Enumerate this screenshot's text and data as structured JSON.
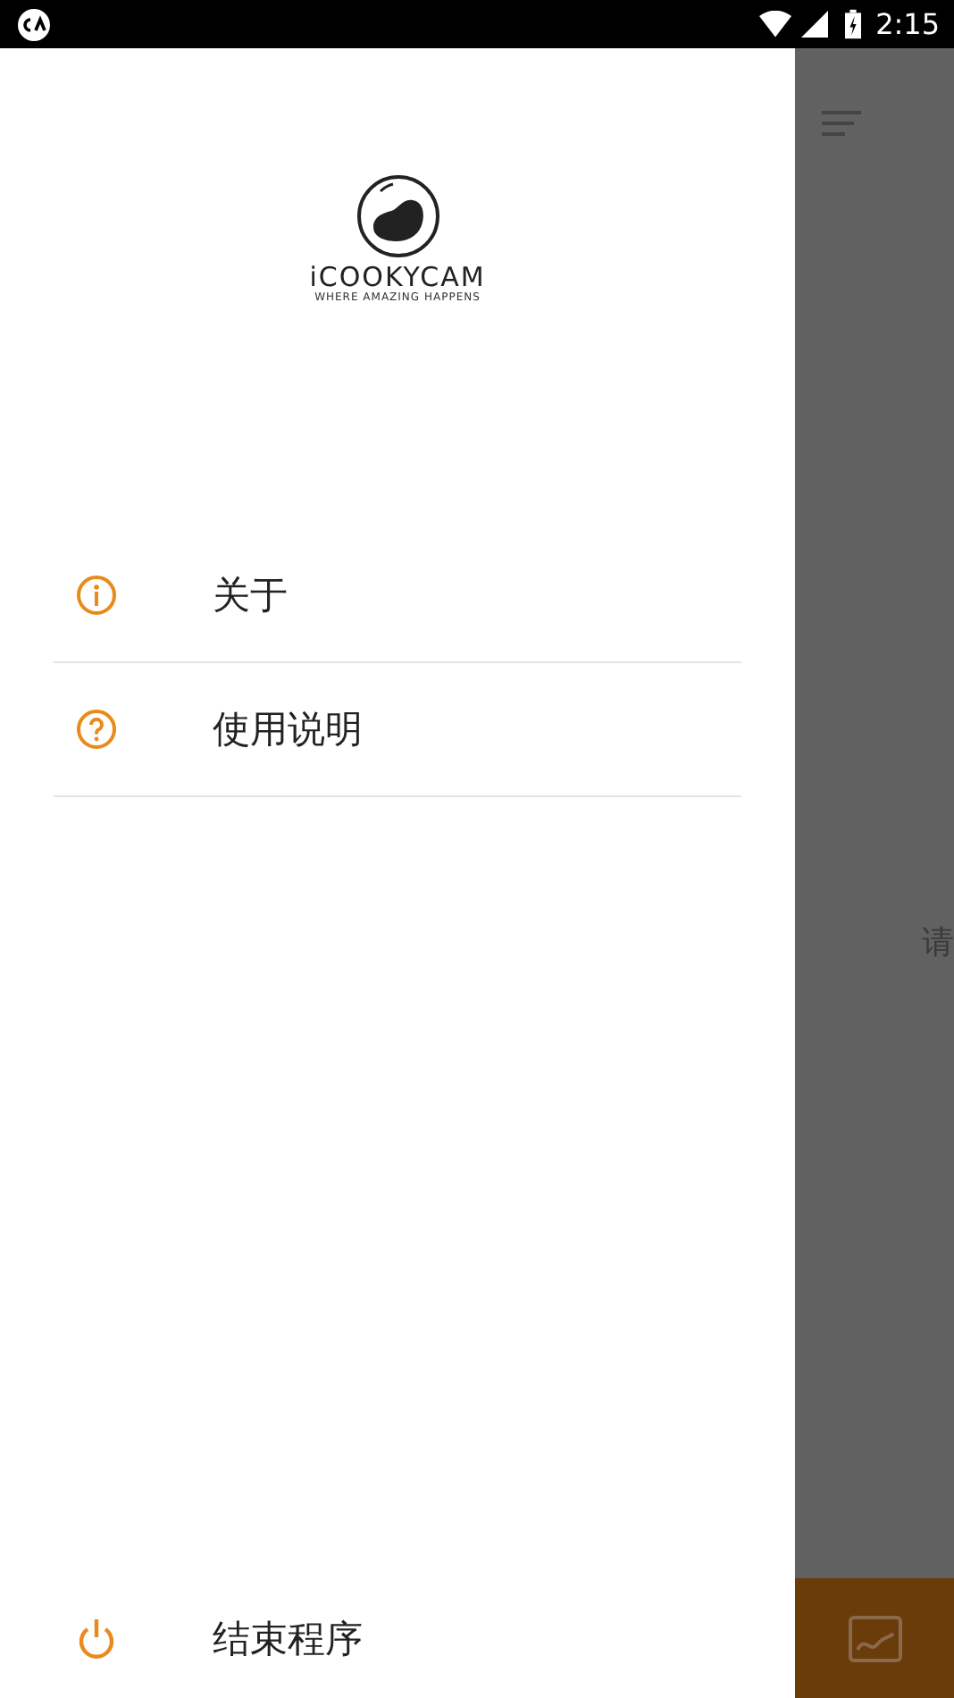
{
  "status_bar": {
    "time": "2:15"
  },
  "drawer": {
    "logo": {
      "name": "iCOOKYCAM",
      "tagline": "WHERE AMAZING HAPPENS"
    },
    "items": [
      {
        "kind": "info",
        "label": "关于"
      },
      {
        "kind": "help",
        "label": "使用说明"
      }
    ],
    "footer_item": {
      "kind": "power",
      "label": "结束程序"
    }
  },
  "background": {
    "hint": "请"
  }
}
